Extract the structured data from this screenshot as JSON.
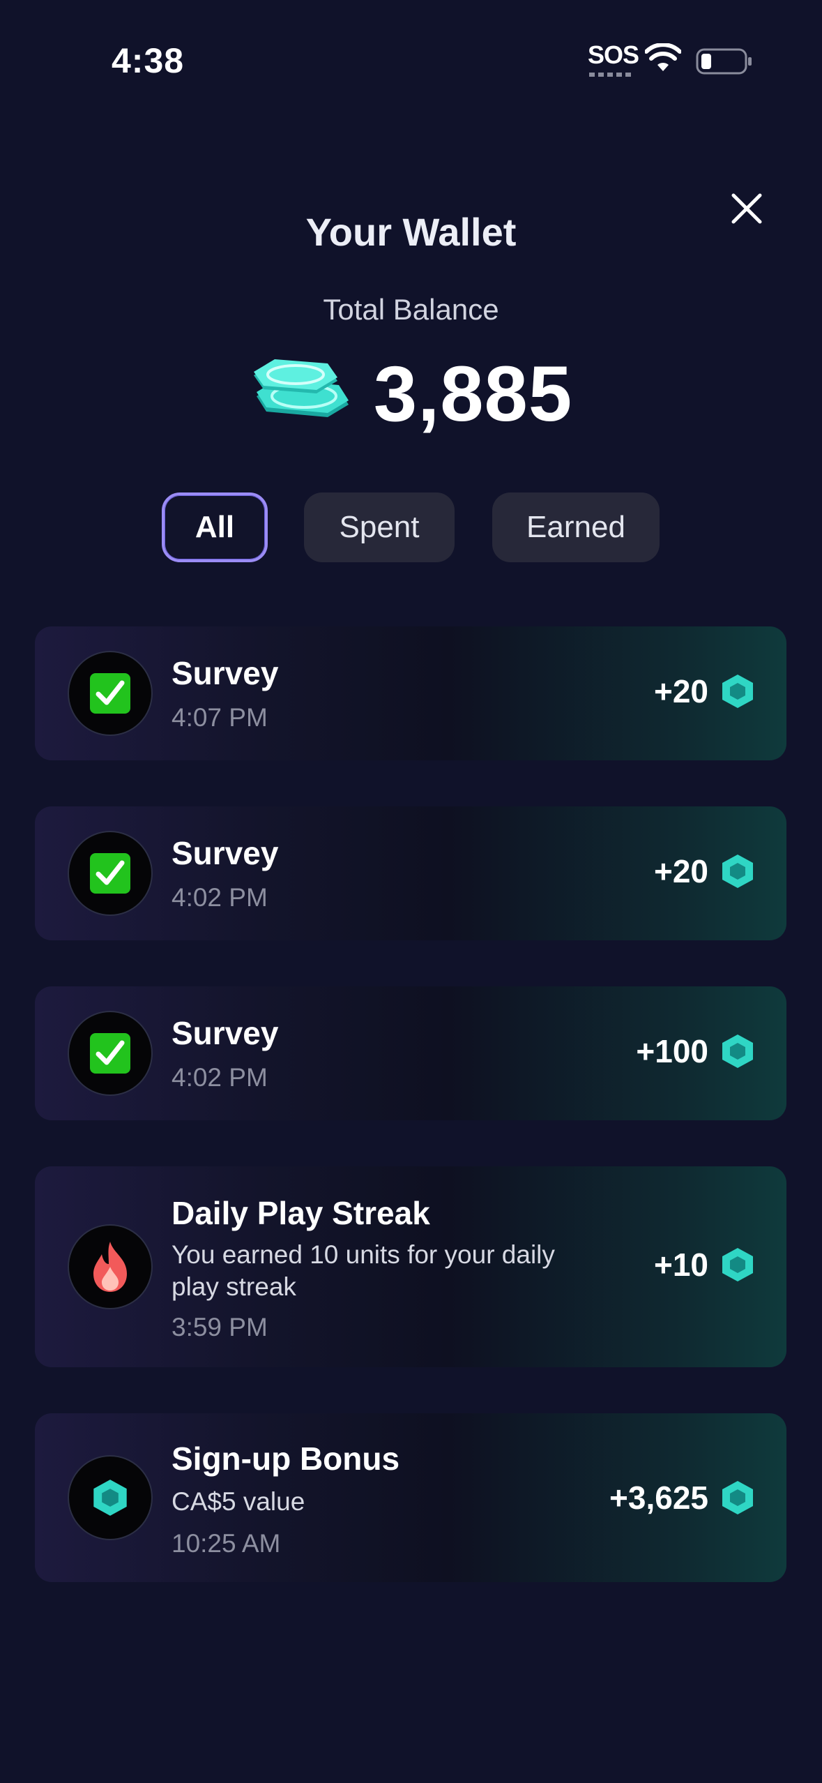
{
  "status_bar": {
    "time": "4:38",
    "sos": "SOS"
  },
  "wallet": {
    "title": "Your Wallet",
    "balance_label": "Total Balance",
    "balance": "3,885"
  },
  "filters": {
    "all": "All",
    "spent": "Spent",
    "earned": "Earned",
    "active": "All"
  },
  "transactions": [
    {
      "title": "Survey",
      "time": "4:07 PM",
      "amount": "+20",
      "icon": "check-mark-icon"
    },
    {
      "title": "Survey",
      "time": "4:02 PM",
      "amount": "+20",
      "icon": "check-mark-icon"
    },
    {
      "title": "Survey",
      "time": "4:02 PM",
      "amount": "+100",
      "icon": "check-mark-icon"
    },
    {
      "title": "Daily Play Streak",
      "desc": "You earned 10 units for your daily play streak",
      "time": "3:59 PM",
      "amount": "+10",
      "icon": "fire-icon"
    },
    {
      "title": "Sign-up Bonus",
      "desc": "CA$5 value",
      "time": "10:25 AM",
      "amount": "+3,625",
      "icon": "gem-icon"
    }
  ],
  "colors": {
    "background": "#10122a",
    "accent_teal": "#2fd6c4",
    "chip_active_border": "#9b8cf5",
    "chip_bg": "#272839",
    "check_green": "#22c31d"
  }
}
